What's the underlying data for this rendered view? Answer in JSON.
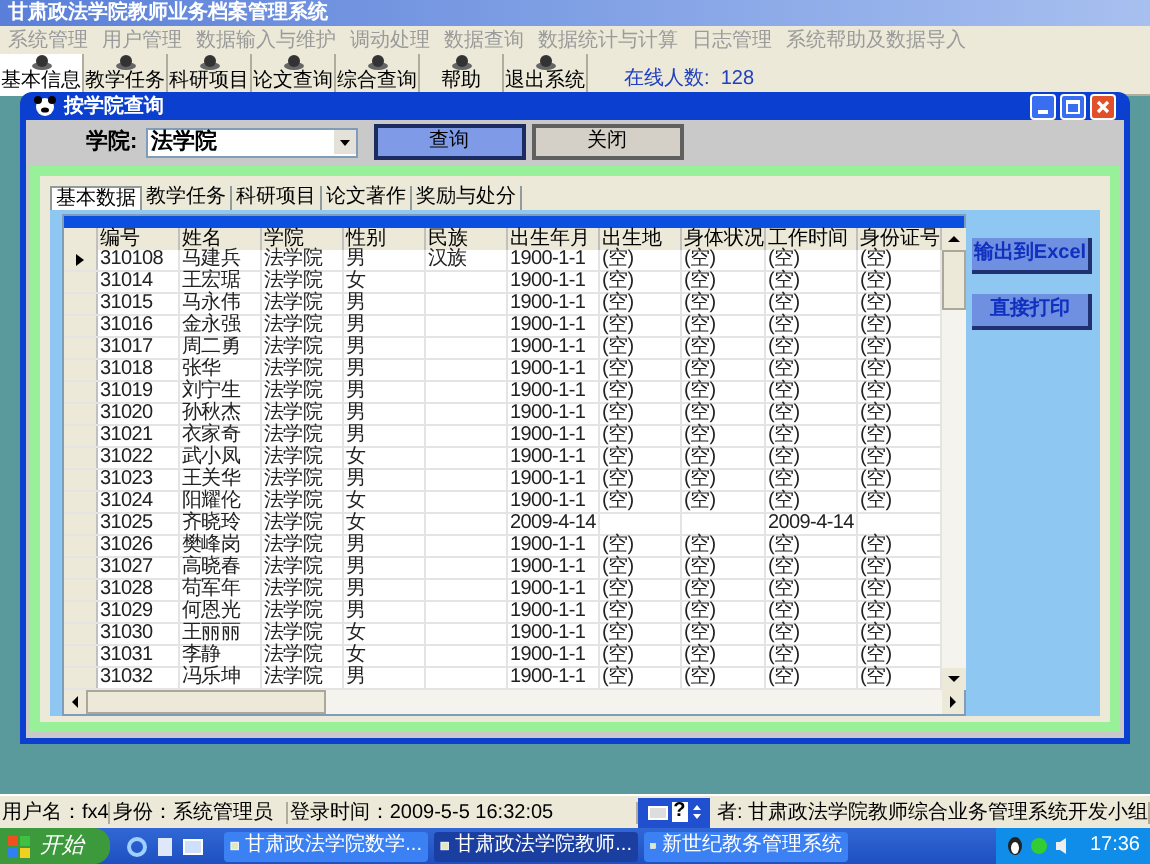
{
  "window": {
    "title": "甘肃政法学院教师业务档案管理系统"
  },
  "menu": [
    {
      "label": "系统管理",
      "disabled": true
    },
    {
      "label": "用户管理",
      "disabled": true
    },
    {
      "label": "数据输入与维护",
      "disabled": true
    },
    {
      "label": "调动处理",
      "disabled": true
    },
    {
      "label": "数据查询",
      "disabled": true
    },
    {
      "label": "数据统计与计算",
      "disabled": true
    },
    {
      "label": "日志管理",
      "disabled": true
    },
    {
      "label": "系统帮助及数据导入",
      "disabled": true
    }
  ],
  "toolbar": [
    {
      "label": "基本信息",
      "selected": true
    },
    {
      "label": "教学任务",
      "selected": false
    },
    {
      "label": "科研项目",
      "selected": false
    },
    {
      "label": "论文查询",
      "selected": false
    },
    {
      "label": "综合查询",
      "selected": false
    },
    {
      "label": "帮助",
      "selected": false
    },
    {
      "label": "退出系统",
      "selected": false
    }
  ],
  "online": {
    "label": "在线人数:",
    "count": "128"
  },
  "dialog": {
    "title": "按学院查询",
    "college_label": "学院:",
    "college_value": "法学院",
    "buttons": [
      {
        "label": "查询",
        "selected": true
      },
      {
        "label": "关闭",
        "selected": false
      }
    ],
    "tabs": [
      {
        "label": "基本数据",
        "selected": true
      },
      {
        "label": "教学任务",
        "selected": false
      },
      {
        "label": "科研项目",
        "selected": false
      },
      {
        "label": "论文著作",
        "selected": false
      },
      {
        "label": "奖励与处分",
        "selected": false
      }
    ],
    "grid": {
      "columns": [
        "编号",
        "姓名",
        "学院",
        "性别",
        "民族",
        "出生年月",
        "出生地",
        "身体状况",
        "工作时间",
        "身份证号"
      ],
      "rows": [
        {
          "current": true,
          "cells": [
            "310108",
            "马建兵",
            "法学院",
            "男",
            "汉族",
            "1900-1-1",
            "(空)",
            "(空)",
            "(空)",
            "(空)"
          ]
        },
        {
          "current": false,
          "cells": [
            "31014",
            "王宏琚",
            "法学院",
            "女",
            "",
            "1900-1-1",
            "(空)",
            "(空)",
            "(空)",
            "(空)"
          ]
        },
        {
          "current": false,
          "cells": [
            "31015",
            "马永伟",
            "法学院",
            "男",
            "",
            "1900-1-1",
            "(空)",
            "(空)",
            "(空)",
            "(空)"
          ]
        },
        {
          "current": false,
          "cells": [
            "31016",
            "金永强",
            "法学院",
            "男",
            "",
            "1900-1-1",
            "(空)",
            "(空)",
            "(空)",
            "(空)"
          ]
        },
        {
          "current": false,
          "cells": [
            "31017",
            "周二勇",
            "法学院",
            "男",
            "",
            "1900-1-1",
            "(空)",
            "(空)",
            "(空)",
            "(空)"
          ]
        },
        {
          "current": false,
          "cells": [
            "31018",
            "张华",
            "法学院",
            "男",
            "",
            "1900-1-1",
            "(空)",
            "(空)",
            "(空)",
            "(空)"
          ]
        },
        {
          "current": false,
          "cells": [
            "31019",
            "刘宁生",
            "法学院",
            "男",
            "",
            "1900-1-1",
            "(空)",
            "(空)",
            "(空)",
            "(空)"
          ]
        },
        {
          "current": false,
          "cells": [
            "31020",
            "孙秋杰",
            "法学院",
            "男",
            "",
            "1900-1-1",
            "(空)",
            "(空)",
            "(空)",
            "(空)"
          ]
        },
        {
          "current": false,
          "cells": [
            "31021",
            "衣家奇",
            "法学院",
            "男",
            "",
            "1900-1-1",
            "(空)",
            "(空)",
            "(空)",
            "(空)"
          ]
        },
        {
          "current": false,
          "cells": [
            "31022",
            "武小凤",
            "法学院",
            "女",
            "",
            "1900-1-1",
            "(空)",
            "(空)",
            "(空)",
            "(空)"
          ]
        },
        {
          "current": false,
          "cells": [
            "31023",
            "王关华",
            "法学院",
            "男",
            "",
            "1900-1-1",
            "(空)",
            "(空)",
            "(空)",
            "(空)"
          ]
        },
        {
          "current": false,
          "cells": [
            "31024",
            "阳耀伦",
            "法学院",
            "女",
            "",
            "1900-1-1",
            "(空)",
            "(空)",
            "(空)",
            "(空)"
          ]
        },
        {
          "current": false,
          "cells": [
            "31025",
            "齐晓玲",
            "法学院",
            "女",
            "",
            "2009-4-14",
            "",
            "",
            "2009-4-14",
            ""
          ]
        },
        {
          "current": false,
          "cells": [
            "31026",
            "樊峰岗",
            "法学院",
            "男",
            "",
            "1900-1-1",
            "(空)",
            "(空)",
            "(空)",
            "(空)"
          ]
        },
        {
          "current": false,
          "cells": [
            "31027",
            "高晓春",
            "法学院",
            "男",
            "",
            "1900-1-1",
            "(空)",
            "(空)",
            "(空)",
            "(空)"
          ]
        },
        {
          "current": false,
          "cells": [
            "31028",
            "苟军年",
            "法学院",
            "男",
            "",
            "1900-1-1",
            "(空)",
            "(空)",
            "(空)",
            "(空)"
          ]
        },
        {
          "current": false,
          "cells": [
            "31029",
            "何恩光",
            "法学院",
            "男",
            "",
            "1900-1-1",
            "(空)",
            "(空)",
            "(空)",
            "(空)"
          ]
        },
        {
          "current": false,
          "cells": [
            "31030",
            "王丽丽",
            "法学院",
            "女",
            "",
            "1900-1-1",
            "(空)",
            "(空)",
            "(空)",
            "(空)"
          ]
        },
        {
          "current": false,
          "cells": [
            "31031",
            "李静",
            "法学院",
            "女",
            "",
            "1900-1-1",
            "(空)",
            "(空)",
            "(空)",
            "(空)"
          ]
        },
        {
          "current": false,
          "cells": [
            "31032",
            "冯乐坤",
            "法学院",
            "男",
            "",
            "1900-1-1",
            "(空)",
            "(空)",
            "(空)",
            "(空)"
          ]
        }
      ]
    },
    "side_buttons": [
      "输出到Excel",
      "直接打印"
    ]
  },
  "status_bar": [
    "用户名：fx4",
    "身份：系统管理员",
    "登录时间：2009-5-5 16:32:05",
    "者: 甘肃政法学院教师综合业务管理系统开发小组"
  ],
  "ime": {
    "help": "?"
  },
  "taskbar": {
    "start": "开始",
    "tasks": [
      {
        "label": "甘肃政法学院数学...",
        "selected": false
      },
      {
        "label": "甘肃政法学院教师...",
        "selected": true
      },
      {
        "label": "新世纪教务管理系统",
        "selected": false
      }
    ],
    "clock": "17:36"
  }
}
